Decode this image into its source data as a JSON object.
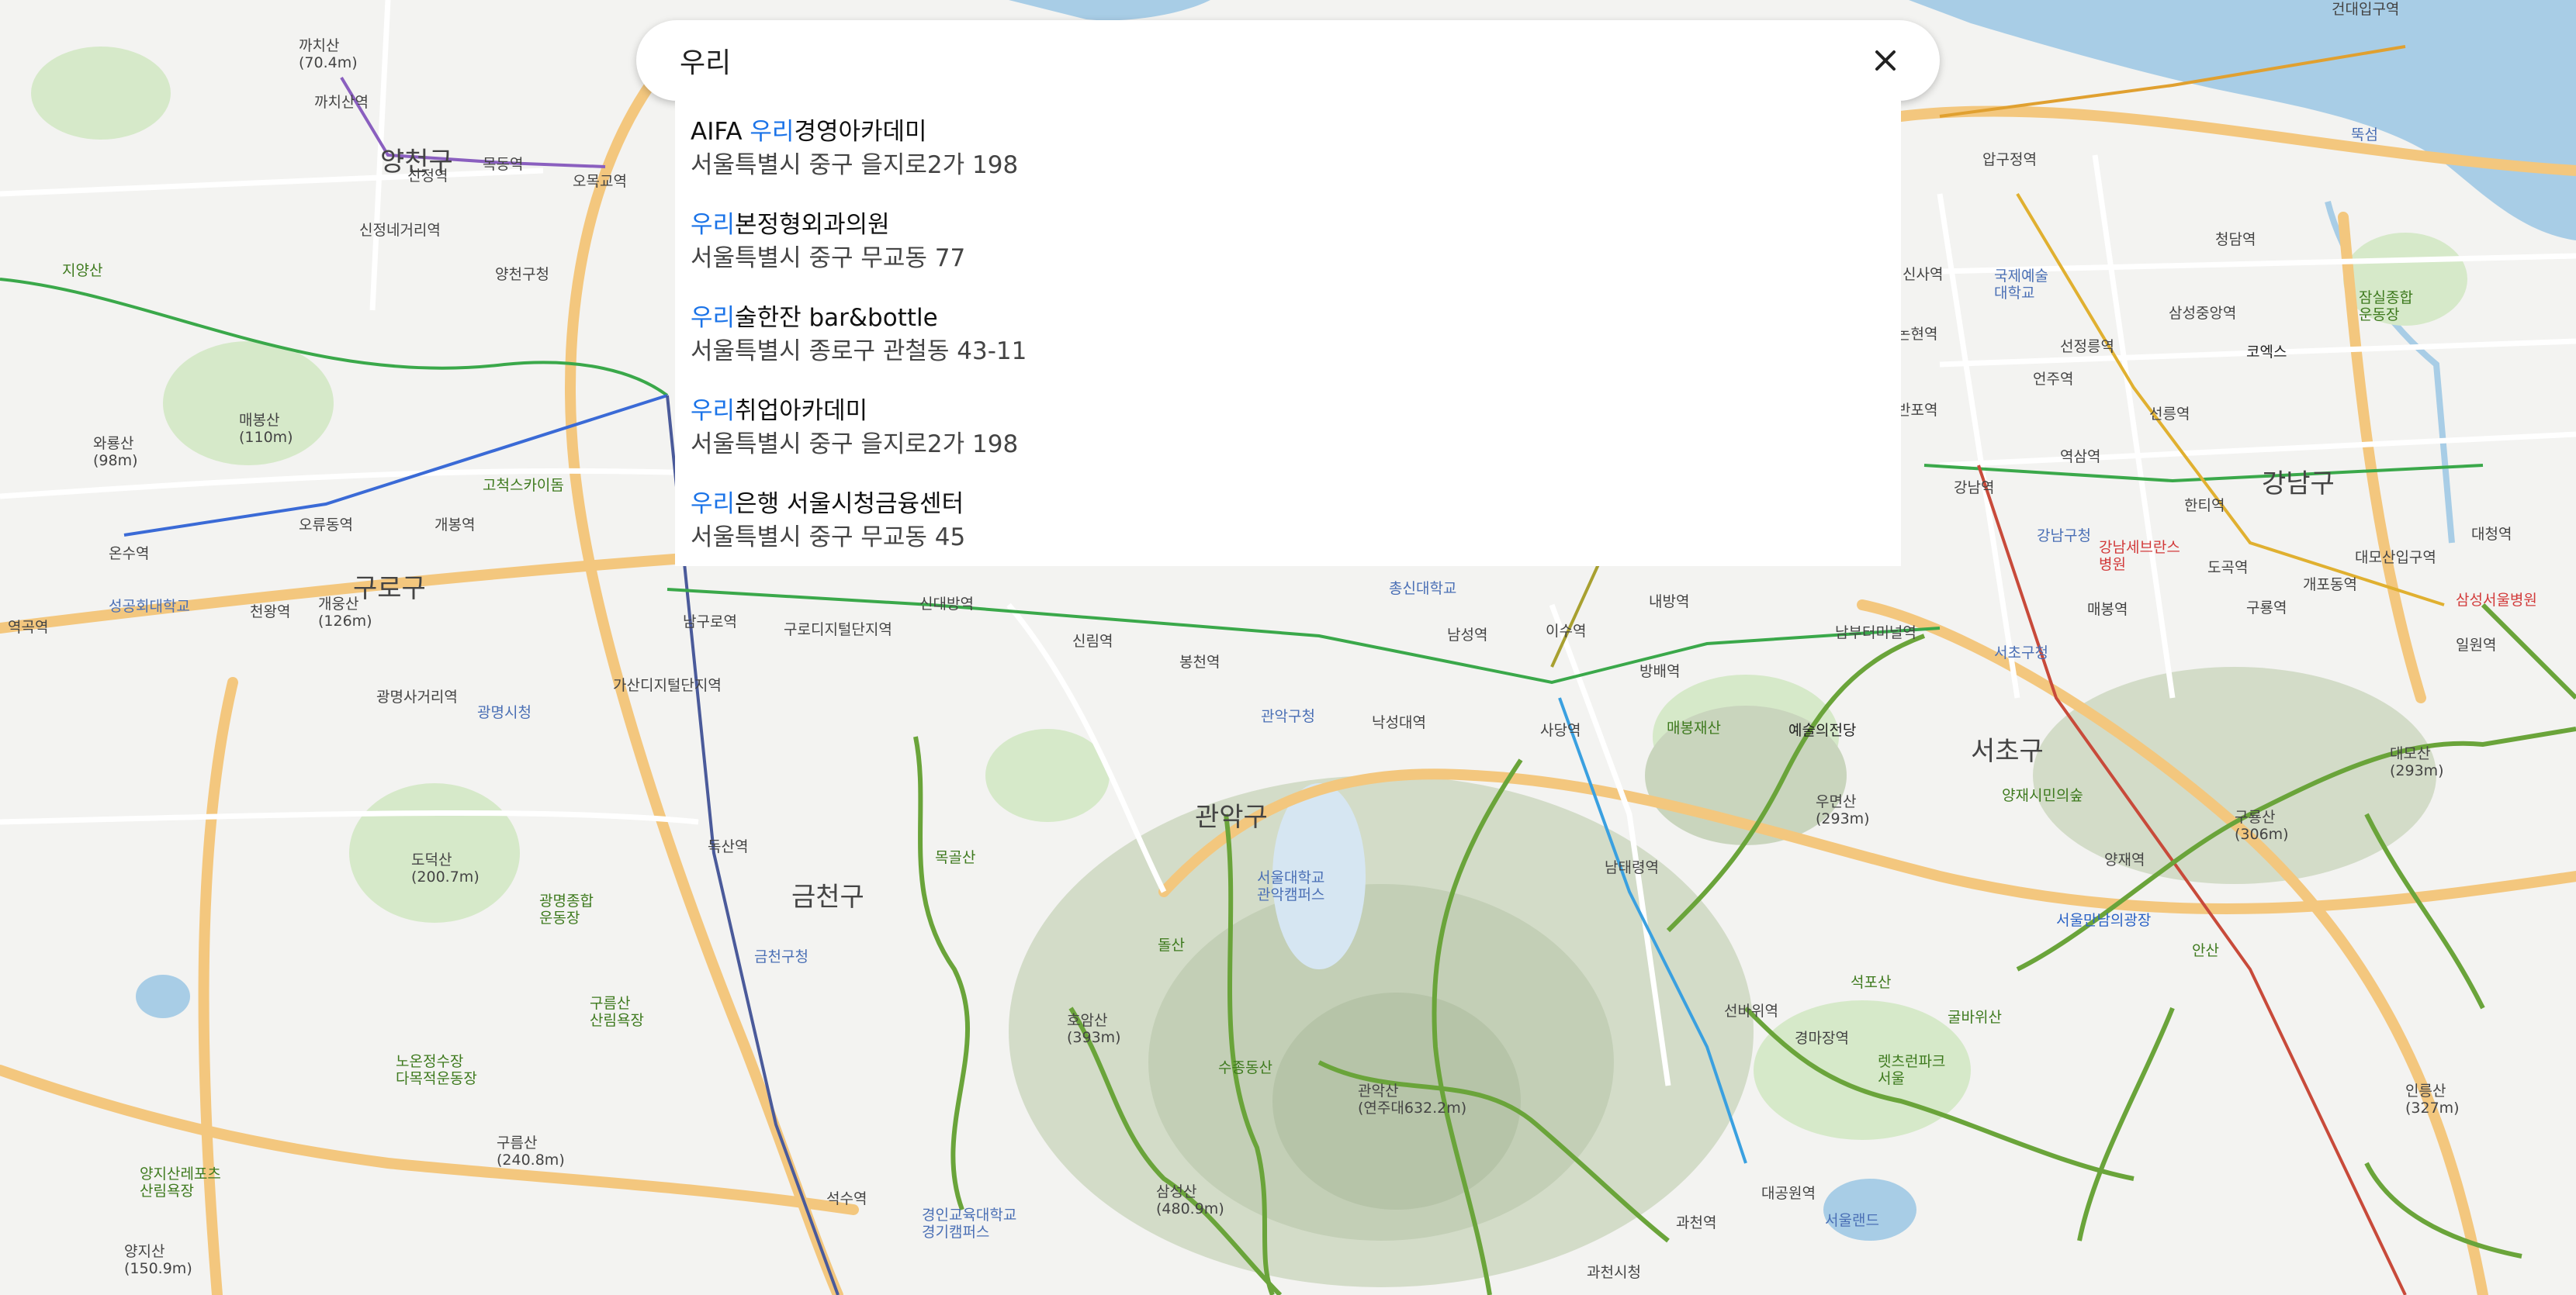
{
  "search": {
    "value": "우리",
    "clear_icon": "close-icon"
  },
  "suggestions": [
    {
      "prefix": "AIFA ",
      "highlight": "우리",
      "rest": "경영아카데미",
      "address": "서울특별시 중구 을지로2가 198"
    },
    {
      "prefix": "",
      "highlight": "우리",
      "rest": "본정형외과의원",
      "address": "서울특별시 중구 무교동 77"
    },
    {
      "prefix": "",
      "highlight": "우리",
      "rest": "술한잔 bar&bottle",
      "address": "서울특별시 종로구 관철동 43-11"
    },
    {
      "prefix": "",
      "highlight": "우리",
      "rest": "취업아카데미",
      "address": "서울특별시 중구 을지로2가 198"
    },
    {
      "prefix": "",
      "highlight": "우리",
      "rest": "은행 서울시청금융센터",
      "address": "서울특별시 중구 무교동 45"
    }
  ],
  "map": {
    "districts": [
      "구로구",
      "금천구",
      "관악구",
      "서초구",
      "강남구",
      "양천구"
    ],
    "stations": [
      "까치산역",
      "신정역",
      "목동역",
      "오목교역",
      "신정네거리역",
      "양천구청",
      "온수역",
      "오류동역",
      "개봉역",
      "천왕역",
      "역곡역",
      "광명사거리역",
      "가산디지털단지역",
      "남구로역",
      "구로디지털단지역",
      "신대방역",
      "신림역",
      "봉천역",
      "낙성대역",
      "사당역",
      "이수역",
      "남성역",
      "내방역",
      "방배역",
      "남태령역",
      "선바위역",
      "경마장역",
      "대공원역",
      "과천역",
      "과천시청",
      "독산역",
      "석수역",
      "강남역",
      "역삼역",
      "선릉역",
      "선정릉역",
      "삼성중앙역",
      "청담역",
      "압구정역",
      "신사역",
      "논현역",
      "언주역",
      "반포역",
      "한티역",
      "도곡역",
      "개포동역",
      "구룡역",
      "대모산입구역",
      "대청역",
      "일원역",
      "양재역",
      "매봉역",
      "남부터미널역",
      "건대입구역"
    ],
    "mountains": [
      "까치산\n(70.4m)",
      "와룡산\n(98m)",
      "매봉산\n(110m)",
      "개웅산\n(126m)",
      "도덕산\n(200.7m)",
      "구름산\n(240.8m)",
      "양지산\n(150.9m)",
      "호암산\n(393m)",
      "삼성산\n(480.9m)",
      "관악산\n(연주대632.2m)",
      "우면산\n(293m)",
      "구룡산\n(306m)",
      "대모산\n(293m)",
      "인릉산\n(327m)"
    ],
    "pois": [
      "성공회대학교",
      "광명시청",
      "금천구청",
      "관악구청",
      "총신대학교",
      "서울대학교\n관악캠퍼스",
      "예술의전당",
      "서초구청",
      "강남구청",
      "국제예술\n대학교",
      "코엑스",
      "강남세브란스\n병원",
      "삼성서울병원",
      "서울만남의광장",
      "서울랜드",
      "렛츠런파크\n서울",
      "양재시민의숲",
      "잠실종합\n운동장",
      "뚝섬",
      "지양산",
      "목골산",
      "돌산",
      "수종동산",
      "석포산",
      "굴바위산",
      "안산",
      "구름산\n산림욕장",
      "노온정수장\n다목적운동장",
      "양지산레포츠\n산림욕장",
      "경인교육대학교\n경기캠퍼스",
      "매봉재산",
      "고척스카이돔",
      "광명종합\n운동장"
    ]
  }
}
